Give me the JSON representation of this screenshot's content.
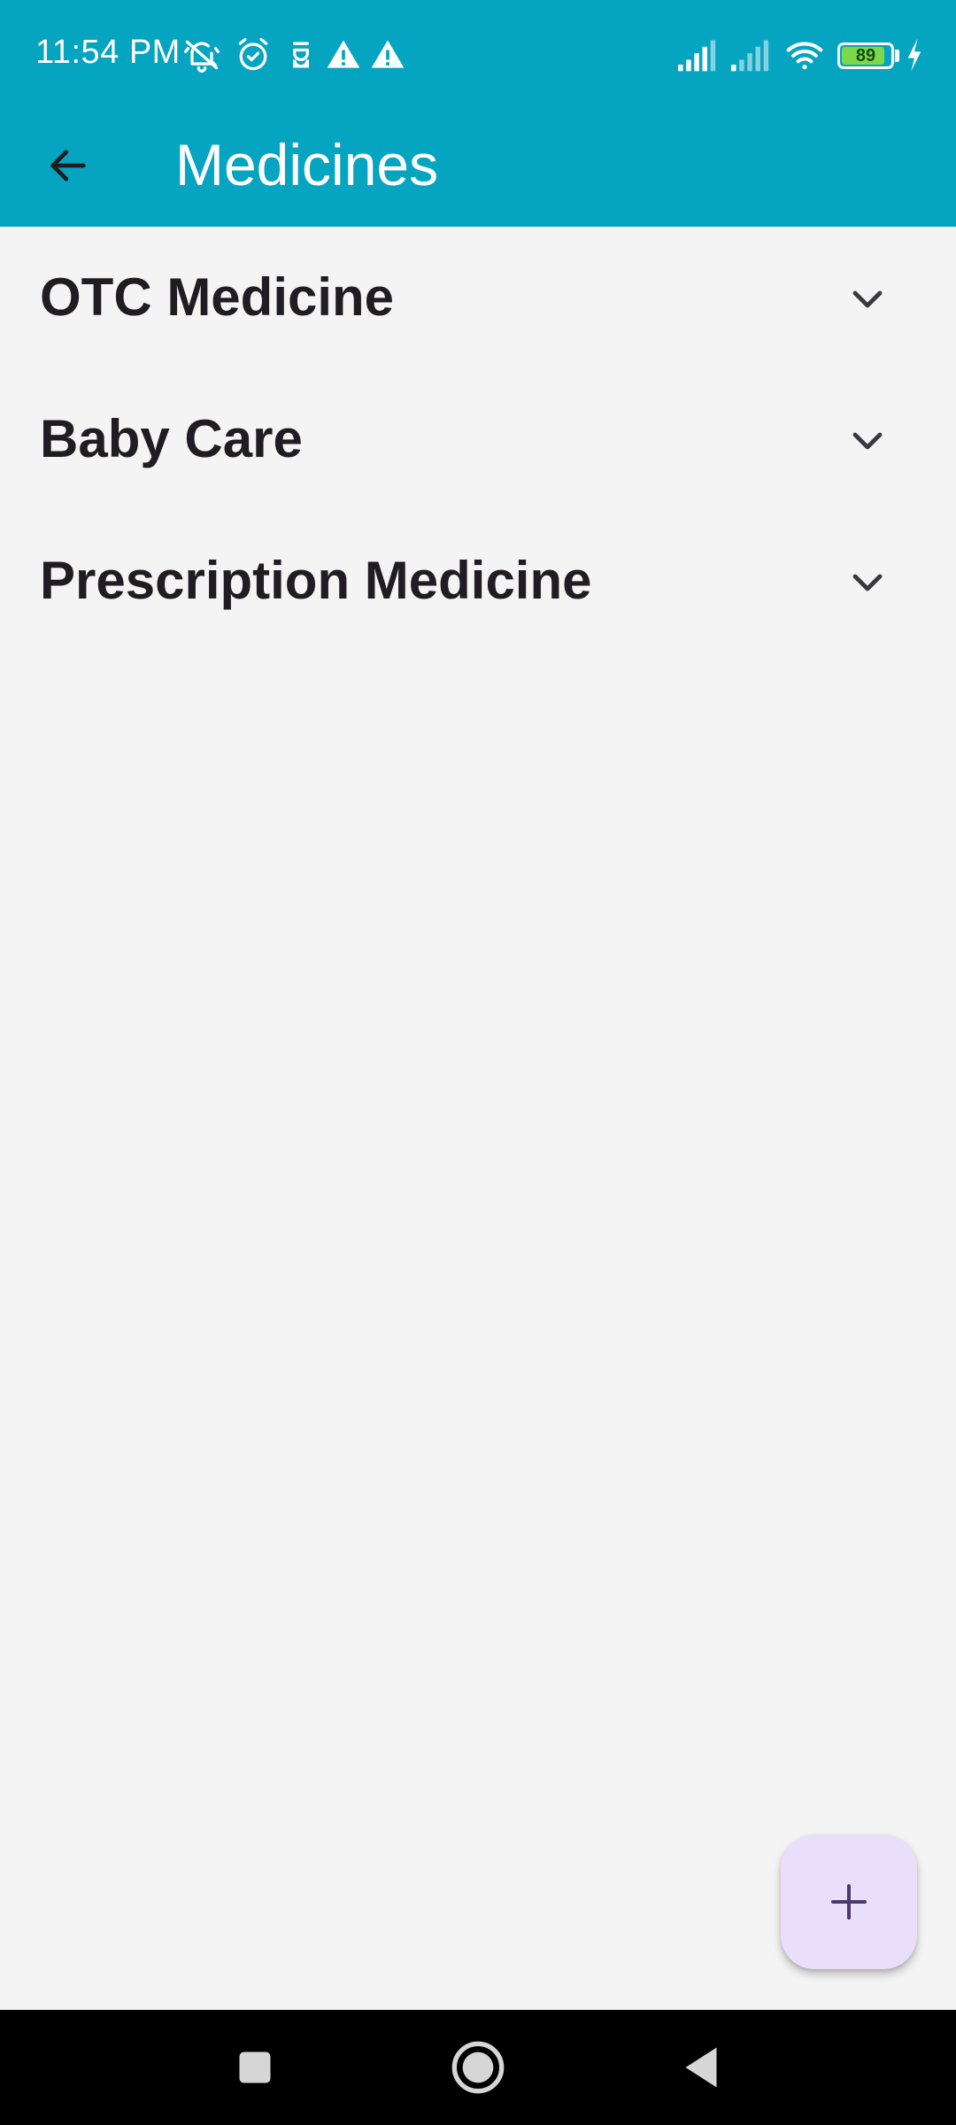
{
  "status_bar": {
    "time": "11:54 PM",
    "battery_level": "89",
    "battery_fraction": 0.89,
    "icons": [
      "muted-bell-icon",
      "alarm-icon",
      "notification-icon",
      "warning-icon",
      "warning-icon",
      "signal-icon",
      "signal-icon",
      "wifi-icon",
      "battery-icon",
      "charging-icon"
    ]
  },
  "app_bar": {
    "title": "Medicines",
    "back_icon": "arrow-back-icon"
  },
  "categories": [
    {
      "label": "OTC Medicine",
      "icon": "chevron-down-icon"
    },
    {
      "label": "Baby Care",
      "icon": "chevron-down-icon"
    },
    {
      "label": "Prescription Medicine",
      "icon": "chevron-down-icon"
    }
  ],
  "fab": {
    "icon": "plus-icon"
  },
  "nav_bar": {
    "buttons": [
      "recents-icon",
      "home-icon",
      "back-icon"
    ]
  },
  "colors": {
    "app_bar": "#05a4c0",
    "background": "#f4f4f4",
    "fab_background": "#eadffb",
    "fab_icon": "#4a3a6e",
    "text": "#1f1d22"
  }
}
